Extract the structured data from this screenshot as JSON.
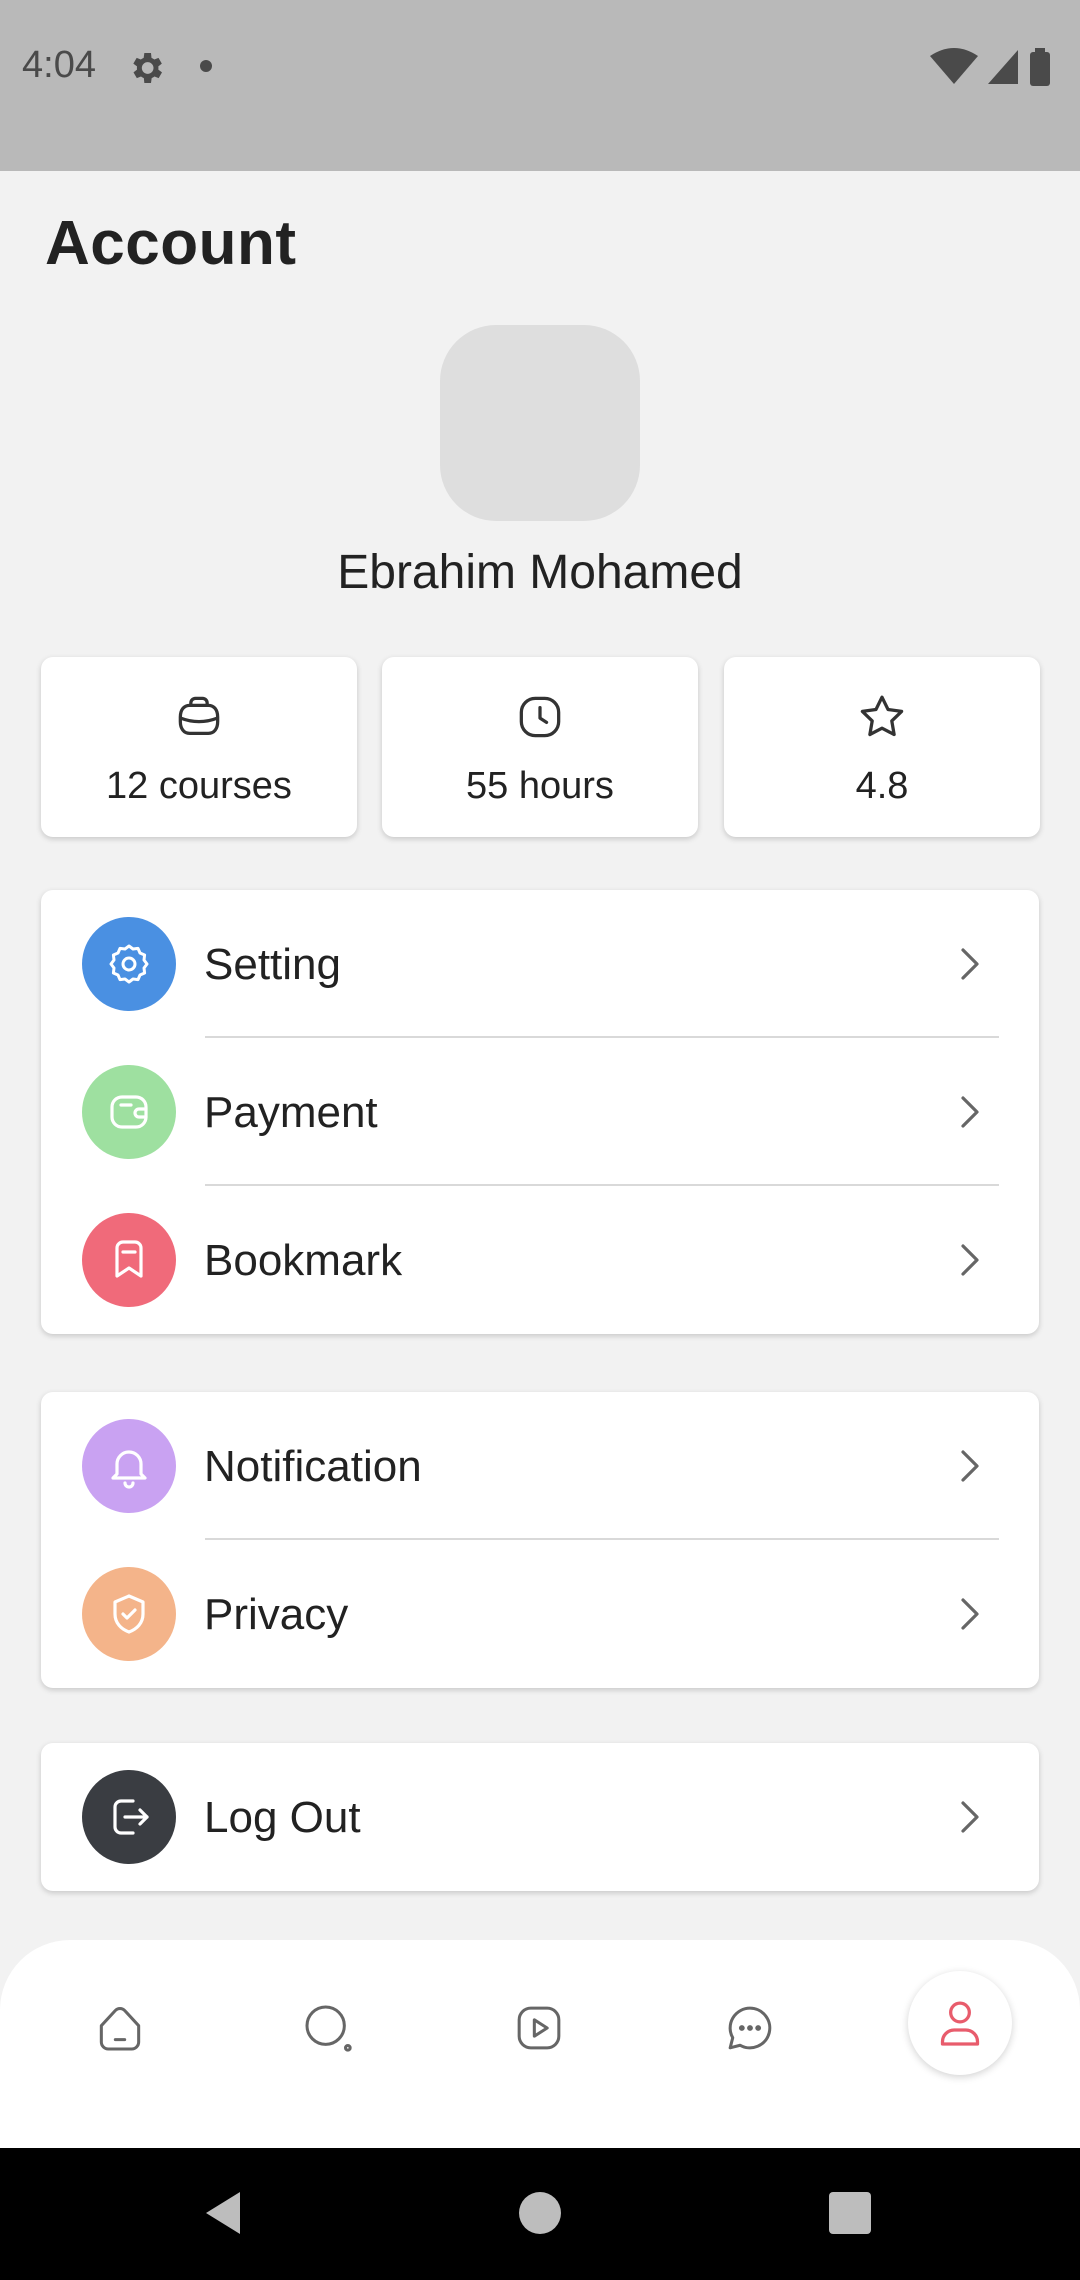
{
  "status_bar": {
    "time": "4:04"
  },
  "page": {
    "title": "Account"
  },
  "profile": {
    "name": "Ebrahim Mohamed"
  },
  "stats": [
    {
      "label": "12 courses",
      "icon": "briefcase-icon"
    },
    {
      "label": "55 hours",
      "icon": "clock-icon"
    },
    {
      "label": "4.8",
      "icon": "star-icon"
    }
  ],
  "menu": {
    "group1": [
      {
        "label": "Setting",
        "icon": "gear-icon",
        "color": "#4a90e2"
      },
      {
        "label": "Payment",
        "icon": "wallet-icon",
        "color": "#9ee0a0"
      },
      {
        "label": "Bookmark",
        "icon": "bookmark-icon",
        "color": "#f06a7a"
      }
    ],
    "group2": [
      {
        "label": "Notification",
        "icon": "bell-icon",
        "color": "#c9a2f2"
      },
      {
        "label": "Privacy",
        "icon": "shield-check-icon",
        "color": "#f4b48a"
      }
    ],
    "group3": [
      {
        "label": "Log Out",
        "icon": "logout-icon",
        "color": "#3a3d42"
      }
    ]
  },
  "bottom_nav": {
    "items": [
      "home-icon",
      "search-icon",
      "play-icon",
      "chat-icon",
      "profile-icon"
    ],
    "active": "profile-icon",
    "active_color": "#e85c6c"
  }
}
